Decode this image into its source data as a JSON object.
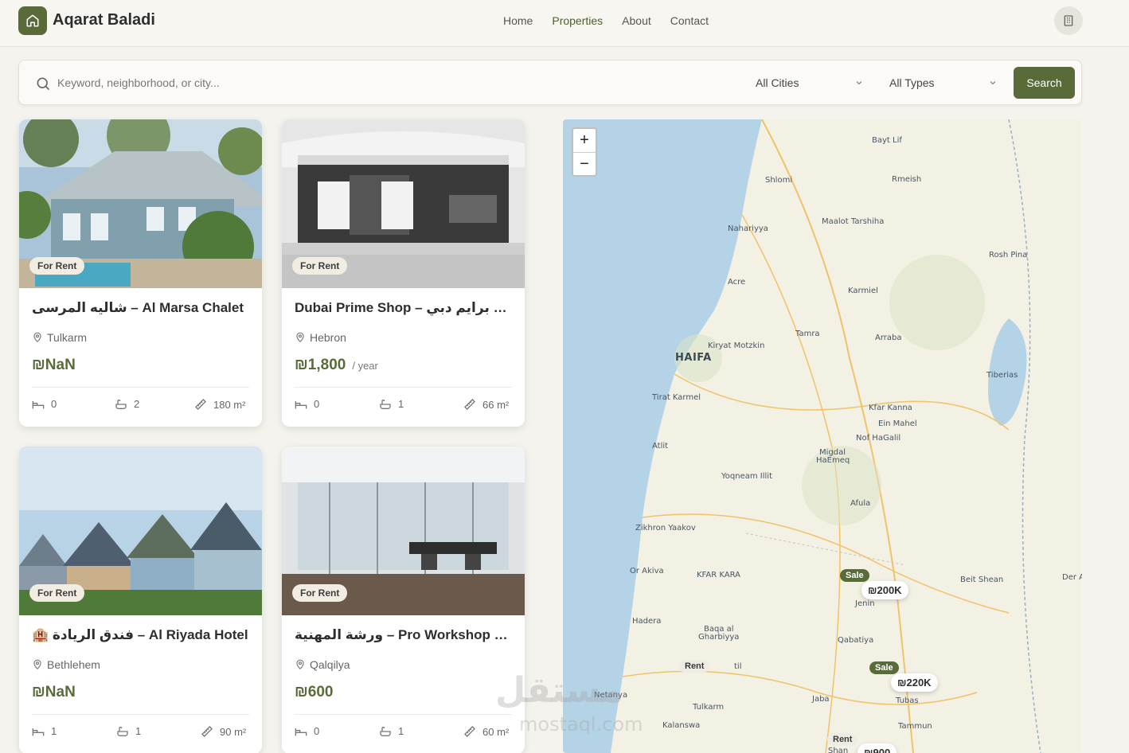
{
  "brand": {
    "name": "Aqarat Baladi",
    "logo_icon": "home-icon"
  },
  "nav": {
    "items": [
      "Home",
      "Properties",
      "About",
      "Contact"
    ],
    "active": "Properties"
  },
  "header": {
    "action_icon": "building-icon"
  },
  "search": {
    "placeholder": "Keyword, neighborhood, or city...",
    "city_select": "All Cities",
    "type_select": "All Types",
    "button_label": "Search"
  },
  "cards": [
    {
      "badge": "For Rent",
      "title": "شاليه المرسى – Al Marsa Chalet",
      "location": "Tulkarm",
      "price": "₪NaN",
      "period": "",
      "beds": "0",
      "baths": "2",
      "area": "180 m²",
      "image": "blue-house-pool"
    },
    {
      "badge": "For Rent",
      "title": "Dubai Prime Shop – محل برايم دبي",
      "location": "Hebron",
      "price": "₪1,800",
      "period": "/ year",
      "beds": "0",
      "baths": "1",
      "area": "66 m²",
      "image": "shop-interior"
    },
    {
      "badge": "For Rent",
      "title": "🏨 فندق الريادة – Al Riyada Hotel",
      "location": "Bethlehem",
      "price": "₪NaN",
      "period": "",
      "beds": "1",
      "baths": "1",
      "area": "90 m²",
      "image": "victorian-houses"
    },
    {
      "badge": "For Rent",
      "title": "ورشة المهنية – Pro Workshop Sp...",
      "location": "Qalqilya",
      "price": "₪600",
      "period": "",
      "beds": "0",
      "baths": "1",
      "area": "60 m²",
      "image": "glass-office"
    }
  ],
  "map": {
    "zoom_in": "+",
    "zoom_out": "−",
    "labels": {
      "bayt_lif": "Bayt Lif",
      "shlomi": "Shlomi",
      "rmeish": "Rmeish",
      "maalot": "Maalot Tarshiha",
      "nahariyya": "Nahariyya",
      "rosh_pina": "Rosh Pina",
      "acre": "Acre",
      "karmiel": "Karmiel",
      "tamra": "Tamra",
      "kiryat": "Kiryat Motzkin",
      "arraba": "Arraba",
      "haifa": "HAIFA",
      "tiberias": "Tiberias",
      "tirat": "Tirat Karmel",
      "kfar_kanna": "Kfar Kanna",
      "ein_mahel": "Ein Mahel",
      "nof": "Nof HaGalil",
      "atlit": "Atlit",
      "migdal1": "Migdal",
      "migdal2": "HaEmeq",
      "yoqneam": "Yoqneam Illit",
      "afula": "Afula",
      "zikhron": "Zikhron Yaakov",
      "or_akiva": "Or Akiva",
      "kfar_kara": "KFAR KARA",
      "jenin": "Jenin",
      "beit_shean": "Beit Shean",
      "der": "Der A",
      "hadera": "Hadera",
      "baqa1": "Baqa al",
      "baqa2": "Gharbiyya",
      "qabatiya": "Qabatiya",
      "til": "til",
      "netanya": "Netanya",
      "jaba": "Jaba",
      "tubas": "Tubas",
      "tulkarm": "Tulkarm",
      "kalanswa": "Kalanswa",
      "tammun": "Tammun",
      "shan": "Shan"
    },
    "markers": [
      {
        "tag": "Sale",
        "price": "₪200K"
      },
      {
        "tag": "Rent",
        "price": ""
      },
      {
        "tag": "Sale",
        "price": "₪220K"
      },
      {
        "tag": "Rent",
        "price": "₪900"
      }
    ]
  },
  "watermark": {
    "text": "مستقل",
    "sub": "mostaql.com"
  }
}
